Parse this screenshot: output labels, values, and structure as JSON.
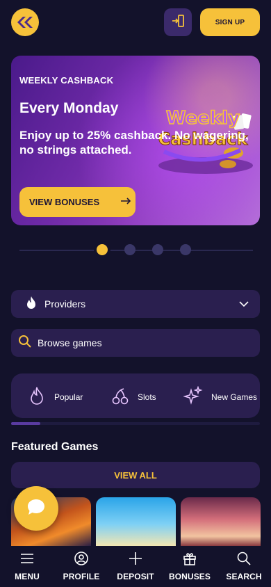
{
  "header": {
    "logo_icon": "brand-logo-icon",
    "login_icon": "login-icon",
    "signup_label": "SIGN UP"
  },
  "banner": {
    "tag": "WEEKLY CASHBACK",
    "title": "Every Monday",
    "description": "Enjoy up to 25% cashback. No wagering, no strings attached.",
    "cta_label": "VIEW BONUSES",
    "cta_icon": "arrow-right-icon",
    "art_text_line1": "Weekly",
    "art_text_line2": "Cashback"
  },
  "carousel": {
    "slide_count": 4,
    "active_index": 0
  },
  "providers": {
    "icon": "flame-icon",
    "label": "Providers",
    "chevron_icon": "chevron-down-icon"
  },
  "search": {
    "icon": "search-icon",
    "placeholder": "Browse games"
  },
  "categories": [
    {
      "icon": "flame-icon",
      "label": "Popular"
    },
    {
      "icon": "cherries-icon",
      "label": "Slots"
    },
    {
      "icon": "sparkles-icon",
      "label": "New Games"
    }
  ],
  "featured": {
    "title": "Featured Games",
    "view_all_label": "VIEW ALL"
  },
  "bottom_nav": [
    {
      "icon": "menu-icon",
      "label": "MENU"
    },
    {
      "icon": "profile-icon",
      "label": "PROFILE"
    },
    {
      "icon": "plus-icon",
      "label": "DEPOSIT"
    },
    {
      "icon": "gift-icon",
      "label": "BONUSES"
    },
    {
      "icon": "search-icon",
      "label": "SEARCH"
    }
  ],
  "colors": {
    "background": "#13122b",
    "accent": "#f6c13a",
    "surface": "#2a1f4f"
  }
}
